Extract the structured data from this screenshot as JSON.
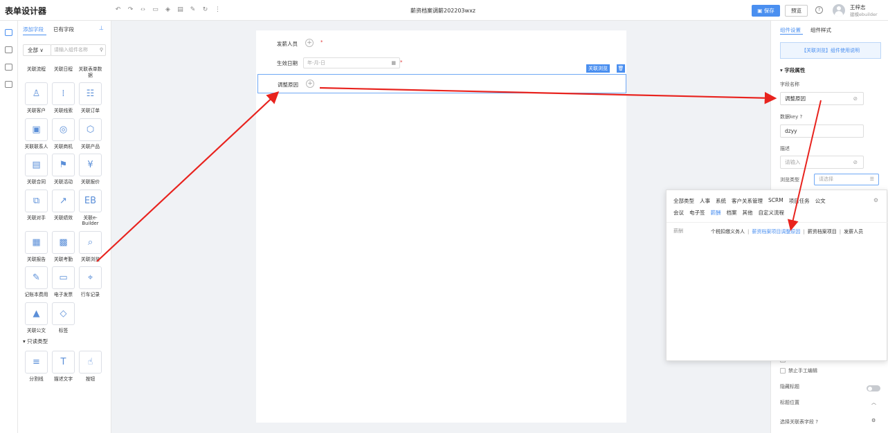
{
  "header": {
    "app_title": "表单设计器",
    "form_name": "薪资档案调薪202203wxz",
    "save_label": "保存",
    "preview_label": "预览",
    "user_name": "王梓志",
    "user_role": "建模ebuilder",
    "toolbar_icons": [
      "undo-icon",
      "redo-icon",
      "code-icon",
      "template-icon",
      "layers-icon",
      "save-draft-icon",
      "edit-form-icon",
      "history-icon",
      "more-icon"
    ]
  },
  "left_panel": {
    "tabs": [
      "添加字段",
      "已有字段"
    ],
    "filter_value": "全部",
    "search_placeholder": "请输入组件名称",
    "field_rows": [
      [
        {
          "label": "关联流程",
          "icon": ""
        },
        {
          "label": "关联日程",
          "icon": ""
        },
        {
          "label": "关联表单数据",
          "icon": ""
        }
      ],
      [
        {
          "label": "关联客户",
          "icon": "user-icon"
        },
        {
          "label": "关联线索",
          "icon": "chart-icon"
        },
        {
          "label": "关联订单",
          "icon": "list-icon"
        }
      ],
      [
        {
          "label": "关联联系人",
          "icon": "contact-icon"
        },
        {
          "label": "关联商机",
          "icon": "target-icon"
        },
        {
          "label": "关联产品",
          "icon": "cube-icon"
        }
      ],
      [
        {
          "label": "关联合同",
          "icon": "contract-icon"
        },
        {
          "label": "关联活动",
          "icon": "flag-icon"
        },
        {
          "label": "关联报价",
          "icon": "yen-icon"
        }
      ],
      [
        {
          "label": "关联对手",
          "icon": "competitor-icon"
        },
        {
          "label": "关联绩效",
          "icon": "trend-icon"
        },
        {
          "label": "关联e-Builder",
          "icon": "eb-icon"
        }
      ],
      [
        {
          "label": "关联报告",
          "icon": "report-icon"
        },
        {
          "label": "关联考勤",
          "icon": "calendar-icon"
        },
        {
          "label": "关联浏览",
          "icon": "browse-icon"
        }
      ],
      [
        {
          "label": "记账本费用",
          "icon": "ledger-icon"
        },
        {
          "label": "电子发票",
          "icon": "invoice-icon"
        },
        {
          "label": "行车记录",
          "icon": "location-icon"
        }
      ],
      [
        {
          "label": "关联公文",
          "icon": "document-icon"
        },
        {
          "label": "标签",
          "icon": "tag-icon"
        }
      ]
    ],
    "readonly_section": "只读类型",
    "readonly_rows": [
      [
        {
          "label": "分割线",
          "icon": "divider-icon"
        },
        {
          "label": "描述文字",
          "icon": "text-icon"
        },
        {
          "label": "按钮",
          "icon": "button-icon"
        }
      ]
    ]
  },
  "canvas": {
    "fields": [
      {
        "label": "发薪人员",
        "required": "*"
      },
      {
        "label": "生效日期",
        "placeholder": "年-月-日",
        "required": "*"
      },
      {
        "label": "调整原因"
      }
    ],
    "selected_tag": "关联浏览"
  },
  "right_panel": {
    "tabs": [
      "组件设置",
      "组件样式"
    ],
    "notice": "【关联浏览】组件使用说明",
    "section": "字段属性",
    "field_name_label": "字段名称",
    "field_name_value": "调整原因",
    "data_key_label": "数据key",
    "data_key_value": "dzyy",
    "desc_label": "描述",
    "desc_placeholder": "请输入",
    "browse_type_label": "浏览类型",
    "browse_type_placeholder": "请选择",
    "disable_manual_edit": "禁止手工编辑",
    "hide_title": "隐藏标题",
    "title_position": "标题位置",
    "select_related_field": "选择关联表字段"
  },
  "popup": {
    "categories_row1": [
      "全部类型",
      "人事",
      "系统",
      "客户关系管理",
      "SCRM",
      "项目任务",
      "公文"
    ],
    "categories_row2": [
      "会议",
      "电子签",
      "薪酬",
      "档案",
      "其他",
      "自定义流程"
    ],
    "active_category": "薪酬",
    "group_label": "薪酬",
    "items": [
      "个税扣缴义务人",
      "薪资档案项目调整原因",
      "薪资档案项目",
      "发薪人员"
    ],
    "active_item": "薪资档案项目调整原因"
  },
  "colors": {
    "accent": "#4a8ff0",
    "annotation_arrow": "#e8231e"
  }
}
